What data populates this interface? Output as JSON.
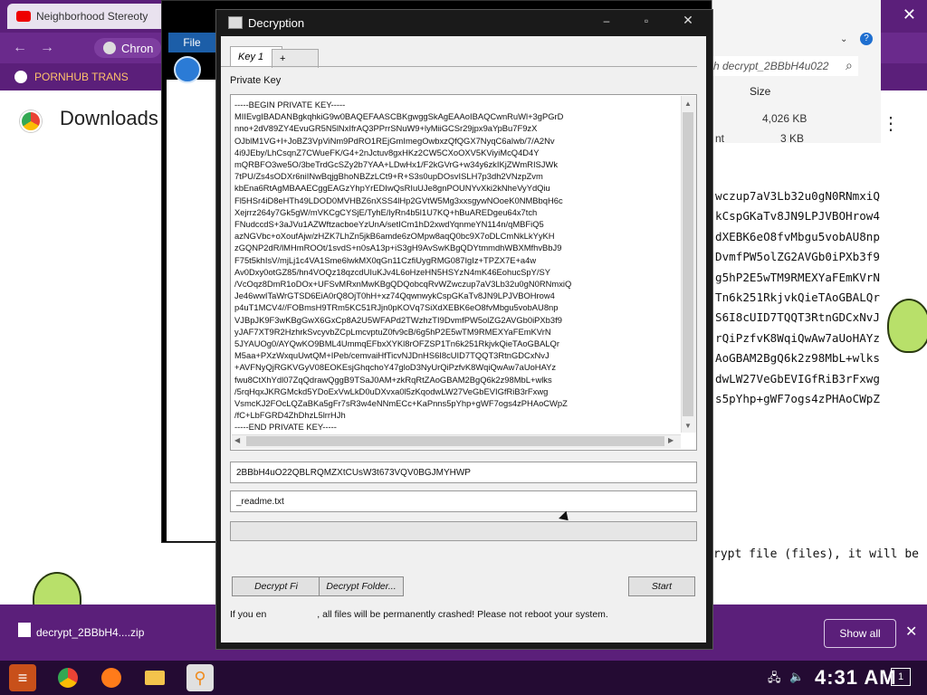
{
  "browser": {
    "tab_title": "Neighborhood Stereoty",
    "omnibox_text": "Chron",
    "bookmark_label": "PORNHUB TRANS",
    "page_title": "Downloads"
  },
  "explorer": {
    "search_placeholder": "h decrypt_2BBbH4u022",
    "size_header": "Size",
    "size_values": [
      "4,026 KB",
      "3 KB"
    ],
    "fragment_label": "nt"
  },
  "readme": {
    "lines": [
      "wczup7aV3Lb32u0gN0RNmxiQ",
      "kCspGKaTv8JN9LPJVBOHrow4",
      "dXEBK6eO8fvMbgu5vobAU8np",
      "DvmfPW5olZG2AVGb0iPXb3f9",
      "g5hP2E5wTM9RMEXYaFEmKVrN",
      "Tn6k251RkjvkQieTAoGBALQr",
      "S6I8cUID7TQQT3RtnGDCxNvJ",
      "rQiPzfvK8WqiQwAw7aUoHAYz",
      "AoGBAM2BgQ6k2z98MbL+wlks",
      "dwLW27VeGbEVIGfRiB3rFxwg",
      "s5pYhp+gWF7ogs4zPHAoCWpZ"
    ],
    "footer_text": "rypt file (files), it will be"
  },
  "dialog": {
    "title": "Decryption",
    "tabs": [
      "Key 1",
      "+"
    ],
    "private_key_label": "Private Key",
    "private_key_text": "-----BEGIN PRIVATE KEY-----\nMIIEvgIBADANBgkqhkiG9w0BAQEFAASCBKgwggSkAgEAAoIBAQCwnRuWl+3gPGrD\nnno+2dV89ZY4EvuGR5N5lNxIfrAQ3PPrrSNuW9+lyMiiGCSr29jpx9aYpBu7F9zX\nOJblM1VG+l+JoBZ3VpViNm9PdRO1REjGmImegOwbxzQfQGX7NyqC6aIwb/7/A2Nv\n4i9JEby/LhCsqnZ7CWueFK/G4+2nJctuv8gxHKz2CW5CXoOXV5KViyiMcQ4D4Y\nmQRBFO3we5O/3beTrdGcSZy2b7YAA+LDwHx1/F2kGVrG+w34y6zkIKjZWmRISJWk\n7tPU/Zs4sODXr6niINwBqjgBhoNBZzLCt9+R+S3s0upDOsvISLH7p3dh2VNzpZvm\nkbEna6RtAgMBAAECggEAGzYhpYrEDIwQsRIuUJe8gnPOUNYvXki2kNheVyYdQiu\nFl5HSr4iD8eHTh49LDOD0MVHBZ6nXSS4lHp2GVtW5Mg3xxsgywNOoeK0NMBbqH6c\nXejrrz264y7Gk5gW/mVKCgCYSjE/TyhE/lyRn4b5l1U7KQ+hBuAREDgeu64x7tch\nFNudccdS+3aJVu1AZWftzacboeYzUnA/setICm1hD2xwdYqnmeYN114n/qMBFiQ5\nazNGVbc+oXoufAjw/zHZK7LhZn5jkB6amde6zOMpw8aqQ0bc9X7oDLCmNkLkYyKH\nzGQNP2dR/lMHmROOt/1svdS+n0sA13p+iS3gH9AvSwKBgQDYtmmdhWBXMfhvBbJ9\nF75t5khIsV/mjLj1c4VA1Sme6lwkMX0qGn11CzfiUygRMG087IgIz+TPZX7E+a4w\nAv0Dxy0otGZ85/hn4VOQz18qzcdUIuKJv4L6oHzeHN5HSYzN4mK46EohucSpY/SY\n/VcOqz8DmR1oDOx+UFSvMRxnMwKBgQDQobcqRvWZwczup7aV3Lb32u0gN0RNmxiQ\nJe46wwITaWrGTSD6EiA0rQ8OjT0hH+xz74QqwnwykCspGKaTv8JN9LPJVBOHrow4\np4uT1MCV4//FOBmsH9TRm5KC51RJjn0pKOVq7SiXdXEBK6eO8fvMbgu5vobAU8np\nVJBpJK9F3wKBgGwX6GxCp8A2U5WFAPd2TWzhzTI9DvmfPW5olZG2AVGb0iPXb3f9\nyJAF7XT9R2HzhrkSvcyvbZCpLmcvptuZ0fv9cB/6g5hP2E5wTM9RMEXYaFEmKVrN\n5JYAUOg0/AYQwKO9BML4UmmqEFbxXYKl8rOFZSP1Tn6k251RkjvkQieTAoGBALQr\nM5aa+PXzWxquUwtQM+IPeb/cemvaiHfTicvNJDnHS6I8cUID7TQQT3RtnGDCxNvJ\n+AVFNyQjRGKVGyV08EOKEsjGhqchoY47gloD3NyUrQiPzfvK8WqiQwAw7aUoHAYz\nfwu8CtXhYdl07ZqQdrawQggB9TSaJ0AM+zkRqRtZAoGBAM2BgQ6k2z98MbL+wlks\n/5rqHqxJKRGMckd5YDoExVwLkD0uDXvxa0l5zKqodwLW27VeGbEVIGfRiB3rFxwg\nVsmcKJ2FOcLQZaBKa5gFr7sR3w4eNNmECc+KaPnns5pYhp+gWF7ogs4zPHAoCWpZ\n/fC+LbFGRD4ZhDhzL5lrrHJh\n-----END PRIVATE KEY-----",
    "key_id": "2BBbH4uO22QBLRQMZXtCUsW3t673VQV0BGJMYHWP",
    "file_name": "_readme.txt",
    "buttons": {
      "decrypt_file": "Decrypt Fi",
      "decrypt_folder": "Decrypt Folder...",
      "start": "Start"
    },
    "warning_left": "If you en",
    "warning_right": ", all files will be permanently crashed! Please not reboot your system."
  },
  "downloads_bar": {
    "file_label": "decrypt_2BBbH4....zip",
    "show_all": "Show all"
  },
  "taskbar": {
    "clock": "4:31 AM",
    "notification_count": "1"
  },
  "colors": {
    "purple": "#5b1f7a",
    "taskbar": "#240b33",
    "dialog_body": "#f0f0f0"
  }
}
